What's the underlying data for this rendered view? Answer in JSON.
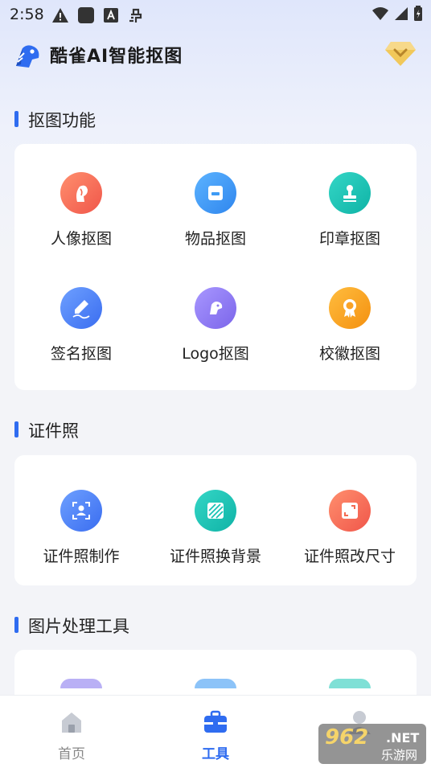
{
  "status_bar": {
    "time": "2:58",
    "icons": [
      "warning-icon",
      "app-square-icon",
      "font-a-icon",
      "bug-icon",
      "wifi-icon",
      "signal-icon",
      "battery-icon"
    ]
  },
  "header": {
    "title": "酷雀AI智能抠图",
    "logo_icon": "bird-logo-icon",
    "vip_icon": "diamond-vip-icon"
  },
  "sections": [
    {
      "title": "抠图功能",
      "items": [
        {
          "label": "人像抠图",
          "icon": "portrait-icon",
          "color": "#f5775e"
        },
        {
          "label": "物品抠图",
          "icon": "box-icon",
          "color": "#3d9bf5"
        },
        {
          "label": "印章抠图",
          "icon": "stamp-icon",
          "color": "#17c2b6"
        },
        {
          "label": "签名抠图",
          "icon": "pen-signature-icon",
          "color": "#4a85f3"
        },
        {
          "label": "Logo抠图",
          "icon": "bird-logo-item-icon",
          "color": "#8c7af0"
        },
        {
          "label": "校徽抠图",
          "icon": "badge-award-icon",
          "color": "#f9a226"
        }
      ]
    },
    {
      "title": "证件照",
      "items": [
        {
          "label": "证件照制作",
          "icon": "id-photo-icon",
          "color": "#4a85f3"
        },
        {
          "label": "证件照换背景",
          "icon": "background-stripes-icon",
          "color": "#17c2b6"
        },
        {
          "label": "证件照改尺寸",
          "icon": "resize-icon",
          "color": "#f5775e"
        }
      ]
    },
    {
      "title": "图片处理工具",
      "items": []
    }
  ],
  "bottom_nav": [
    {
      "label": "首页",
      "icon": "home-icon",
      "active": false
    },
    {
      "label": "工具",
      "icon": "toolbox-icon",
      "active": true
    },
    {
      "label": "",
      "icon": "profile-icon",
      "active": false
    }
  ],
  "watermark": {
    "main": "962",
    "net": ".NET",
    "sub": "乐游网"
  }
}
